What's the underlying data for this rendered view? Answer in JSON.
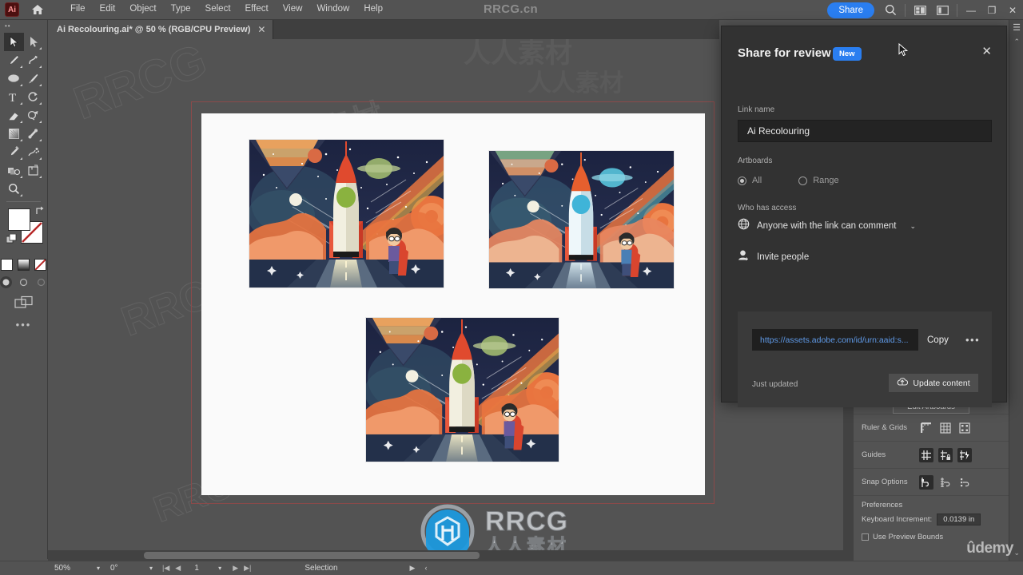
{
  "app": {
    "name": "Adobe Illustrator",
    "logo_text": "Ai",
    "watermark_top": "RRCG.cn",
    "watermark_brand": "RRCG",
    "watermark_brand_cn": "人人素材",
    "watermark_udemy": "ûdemy"
  },
  "menu": {
    "items": [
      {
        "label": "File"
      },
      {
        "label": "Edit"
      },
      {
        "label": "Object"
      },
      {
        "label": "Type"
      },
      {
        "label": "Select"
      },
      {
        "label": "Effect"
      },
      {
        "label": "View"
      },
      {
        "label": "Window"
      },
      {
        "label": "Help"
      }
    ],
    "share_label": "Share"
  },
  "window_controls": {
    "minimize": "—",
    "restore": "❐",
    "close": "✕"
  },
  "document_tab": {
    "title": "Ai Recolouring.ai* @ 50 % (RGB/CPU Preview)",
    "close": "✕"
  },
  "toolbar": {
    "tools": [
      {
        "name": "selection-tool",
        "selected": true
      },
      {
        "name": "direct-selection-tool",
        "selected": false
      },
      {
        "name": "pen-tool",
        "selected": false
      },
      {
        "name": "curvature-tool",
        "selected": false
      },
      {
        "name": "ellipse-tool",
        "selected": false
      },
      {
        "name": "paintbrush-tool",
        "selected": false
      },
      {
        "name": "type-tool",
        "selected": false
      },
      {
        "name": "rotate-tool",
        "selected": false
      },
      {
        "name": "eraser-tool",
        "selected": false
      },
      {
        "name": "shape-builder-tool",
        "selected": false
      },
      {
        "name": "gradient-tool",
        "selected": false
      },
      {
        "name": "width-tool",
        "selected": false
      },
      {
        "name": "eyedropper-tool",
        "selected": false
      },
      {
        "name": "symbol-sprayer-tool",
        "selected": false
      },
      {
        "name": "blend-tool",
        "selected": false
      },
      {
        "name": "artboard-tool",
        "selected": false
      },
      {
        "name": "zoom-tool",
        "selected": false
      }
    ],
    "fill_color": "#ffffff",
    "stroke_color": "#ffffff",
    "more_tools": "•••"
  },
  "canvas": {
    "artboard_border_color": "#8b4a4a",
    "artboard_background": "#fafafa",
    "artworks": [
      {
        "name": "rocket-artwork-original",
        "accent": "#8ab23f",
        "planet": "#9fb870",
        "window_color": "#8ab23f"
      },
      {
        "name": "rocket-artwork-recolour-blue",
        "accent": "#4fc3e0",
        "planet": "#5fc4d8",
        "window_color": "#4fc3e0"
      },
      {
        "name": "rocket-artwork-recolour-green",
        "accent": "#8ab23f",
        "planet": "#9fb870",
        "window_color": "#8ab23f"
      }
    ]
  },
  "share_panel": {
    "title": "Share for review",
    "badge": "New",
    "close": "✕",
    "link_name_label": "Link name",
    "link_name_value": "Ai Recolouring",
    "artboards_label": "Artboards",
    "artboards_options": [
      {
        "label": "All",
        "selected": true
      },
      {
        "label": "Range",
        "selected": false
      }
    ],
    "access_label": "Who has access",
    "access_value": "Anyone with the link can comment",
    "access_chevron": "⌄",
    "invite_label": "Invite people",
    "link_url": "https://assets.adobe.com/id/urn:aaid:s...",
    "copy_label": "Copy",
    "more_label": "•••",
    "status_text": "Just updated",
    "update_label": "Update content"
  },
  "properties_panel": {
    "edit_artboards_label": "Edit Artboards",
    "rows": [
      {
        "label": "Ruler & Grids",
        "icons": [
          {
            "name": "show-rulers-icon",
            "active": false
          },
          {
            "name": "show-grid-icon",
            "active": false
          },
          {
            "name": "show-transparency-grid-icon",
            "active": false
          }
        ]
      },
      {
        "label": "Guides",
        "icons": [
          {
            "name": "show-guides-icon",
            "active": true
          },
          {
            "name": "lock-guides-icon",
            "active": true
          },
          {
            "name": "smart-guides-icon",
            "active": true
          }
        ]
      },
      {
        "label": "Snap Options",
        "icons": [
          {
            "name": "snap-to-point-icon",
            "active": true
          },
          {
            "name": "snap-to-grid-icon",
            "active": false
          },
          {
            "name": "snap-to-pixel-icon",
            "active": false
          }
        ]
      }
    ],
    "preferences_label": "Preferences",
    "keyboard_increment_label": "Keyboard Increment:",
    "keyboard_increment_value": "0.0139 in",
    "use_preview_bounds_label": "Use Preview Bounds",
    "use_preview_bounds_checked": false
  },
  "status_bar": {
    "zoom": "50%",
    "rotation": "0°",
    "page": "1",
    "tool": "Selection",
    "first_icon": "|◀",
    "prev_icon": "◀",
    "next_icon": "▶",
    "last_icon": "▶|",
    "play_icon": "▶",
    "collapse_icon": "‹"
  }
}
